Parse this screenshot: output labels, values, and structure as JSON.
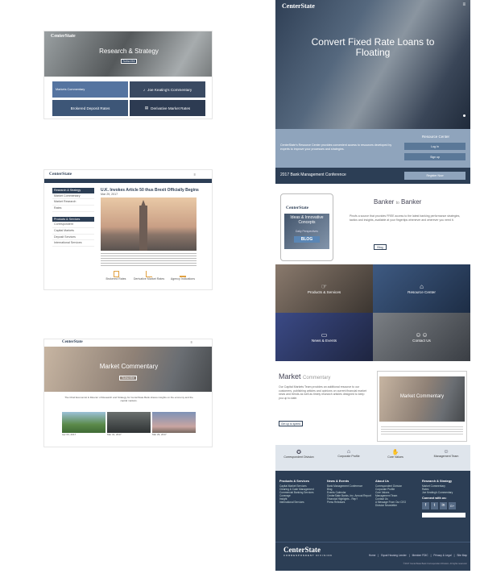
{
  "brand": {
    "name": "CenterState",
    "tagline": "CORRESPONDENT DIVISION"
  },
  "shot1": {
    "hero_title": "Research & Strategy",
    "subscribe": "Subscribe",
    "tiles": [
      "Markets Commentary",
      "Joe Keating's Commentary",
      "Brokered Deposit Rates",
      "Derivative Market Rates"
    ]
  },
  "shot2": {
    "article_title": "U.K. Invokes Article 50 thus Brexit Officially Begins",
    "date": "Mar 29, 2017",
    "sidebar_top": [
      "Research & Strategy",
      "Market Commentary",
      "Market Research",
      "Rates"
    ],
    "sidebar_mid": [
      "Products & Services",
      "Correspondent",
      "Capital Markets",
      "Deposit Services",
      "International Services"
    ],
    "cards": [
      "Brokered Rates",
      "Derivative Market Rates",
      "Agency Indications"
    ]
  },
  "shot3": {
    "hero_title": "Market Commentary",
    "subscribe": "Subscribe",
    "intro": "The Chief Economist & Director of Research and Strategy for CenterState Bank shares insights on the economy and the capital markets.",
    "items": [
      "Apr 03, 2017",
      "Mar 31, 2017",
      "Mar 29, 2017"
    ]
  },
  "right": {
    "hero_title": "Convert Fixed Rate Loans to Floating",
    "resource_center": "Resource Center",
    "resource_text": "CenterState's Resource Center provides convenient access to resources developed by experts to improve your processes and strategies.",
    "login": "Log In",
    "signup": "Sign up",
    "conference": "2017 Bank Management Conference",
    "register": "Register Now",
    "phone_line1": "Ideas & Innovative Concepts",
    "phone_line2": "Daily Perspectives",
    "phone_blog": "BLOG",
    "banker_title": "Banker",
    "banker_to": "to",
    "banker_title2": "Banker",
    "banker_text": "Pinofs a source that provides FREE access to the latest banking performance strategies, tactics and insights, available at your fingertips whenever and wherever you need it.",
    "blog_btn": "Blog",
    "tiles": [
      "Products & Services",
      "Resource Center",
      "News & Events",
      "Contact Us"
    ],
    "market_title": "Market",
    "market_title2": "Commentary",
    "market_text": "Our Capital Markets Team provides an additional resource to our customers, publishing articles and opinions on current financial market news and trends as well as timely research articles designed to keep you up to date.",
    "market_btn": "Get up to speed",
    "preview_title": "Market Commentary",
    "icons": [
      "Correspondent Division",
      "Corporate Profile",
      "Core Values",
      "Management Team"
    ],
    "footer_cols": [
      {
        "head": "Products & Services",
        "items": [
          "Capital Market Services",
          "Clearing & Cash Management",
          "Commercial Banking Services",
          "Coverage",
          "Insight",
          "International Services"
        ]
      },
      {
        "head": "News & Events",
        "items": [
          "Bank Management Conference",
          "Blog",
          "Events Calendar",
          "CenterState Banks, Inc. Annual Report",
          "Financial Highlights - Rep?",
          "Press Releases"
        ]
      },
      {
        "head": "About Us",
        "items": [
          "Correspondent Division",
          "Corporate Profile",
          "Core Values",
          "Management Team",
          "Contact Us",
          "A Message From Our CEO",
          "Division Newsletter"
        ]
      },
      {
        "head": "Research & Strategy",
        "items": [
          "Market Commentary",
          "Rates",
          "Joe Keating's Commentary"
        ]
      }
    ],
    "connect": "Connect with us:",
    "bottom_links": [
      "Home",
      "Equal Housing Lender",
      "Member FDIC",
      "Privacy & Legal",
      "Site Map"
    ],
    "copyright": "©2017 CenterState Bank Correspondent Division. All rights reserved."
  }
}
